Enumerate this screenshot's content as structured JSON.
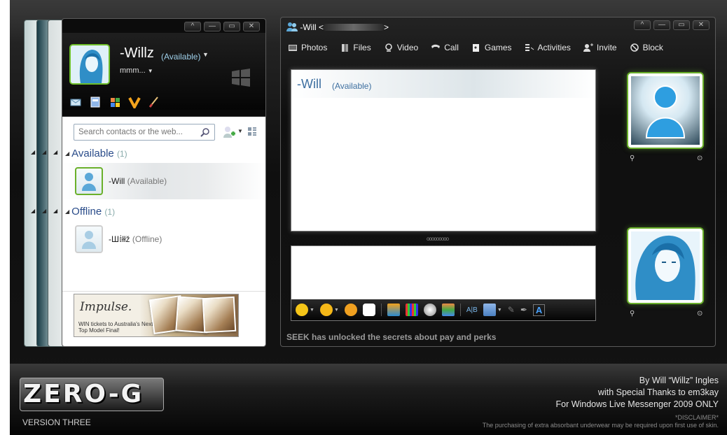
{
  "contact_window": {
    "controls": [
      "^",
      "—",
      "▭",
      "✕"
    ],
    "me": {
      "name": "-Willz",
      "status": "(Available)",
      "personal_message": "mmm..."
    },
    "search": {
      "placeholder": "Search contacts or the web..."
    },
    "groups": [
      {
        "name": "Available",
        "count": "(1)",
        "contacts": [
          {
            "name": "-Will",
            "status": "(Available)"
          }
        ]
      },
      {
        "name": "Offline",
        "count": "(1)",
        "contacts": [
          {
            "name": "-Ш𝕚łłž",
            "status": "(Offline)"
          }
        ]
      }
    ],
    "ad": {
      "brand": "Impulse.",
      "text": "WIN tickets to Australia's Next Top Model Final!"
    }
  },
  "conversation_window": {
    "title": "-Will <",
    "title_suffix": ">",
    "menu": [
      {
        "label": "Photos",
        "icon": "photos-icon"
      },
      {
        "label": "Files",
        "icon": "files-icon"
      },
      {
        "label": "Video",
        "icon": "video-icon"
      },
      {
        "label": "Call",
        "icon": "call-icon"
      },
      {
        "label": "Games",
        "icon": "games-icon"
      },
      {
        "label": "Activities",
        "icon": "activities-icon"
      },
      {
        "label": "Invite",
        "icon": "invite-icon"
      },
      {
        "label": "Block",
        "icon": "block-icon"
      }
    ],
    "history": {
      "name": "-Will",
      "status": "(Available)"
    },
    "splitter": "ooooooooo",
    "status_bar": "SEEK has unlocked the secrets about pay and perks"
  },
  "footer": {
    "logo": "ZERO-G",
    "version": "VERSION THREE",
    "credits": [
      "By Will “Willz” Ingles",
      "with Special Thanks to em3kay",
      "For Windows Live Messenger 2009 ONLY"
    ],
    "disclaimer_title": "*DISCLAIMER*",
    "disclaimer_text": "The purchasing of extra absorbant underwear may be required upon first use of skin."
  },
  "colors": {
    "accent_green": "#6ab02a",
    "link_blue": "#3d6fa0",
    "header_blue": "#2a4c8a"
  }
}
